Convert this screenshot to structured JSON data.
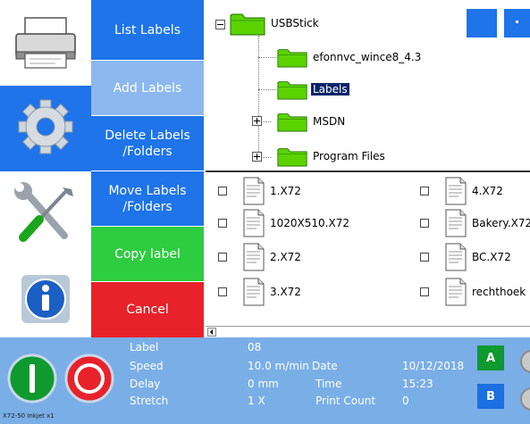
{
  "rail": {
    "items": [
      {
        "name": "printer"
      },
      {
        "name": "settings"
      },
      {
        "name": "tools"
      },
      {
        "name": "info"
      }
    ]
  },
  "menu": {
    "list_labels": "List Labels",
    "add_labels": "Add Labels",
    "delete_labels": "Delete Labels\n/Folders",
    "move_labels": "Move Labels\n/Folders",
    "copy_label": "Copy label",
    "cancel": "Cancel"
  },
  "tree": {
    "root": "USBStick",
    "children": [
      "efonnvc_wince8_4.3",
      "Labels",
      "MSDN",
      "Program Files"
    ]
  },
  "files": {
    "left": [
      "1.X72",
      "1020X510.X72",
      "2.X72",
      "3.X72"
    ],
    "right": [
      "4.X72",
      "Bakery.X72",
      "BC.X72",
      "rechthoek"
    ]
  },
  "status": {
    "label_key": "Label",
    "label_value": "08",
    "speed_key": "Speed",
    "speed_value": "10.0 m/min",
    "delay_key": "Delay",
    "delay_value": "0 mm",
    "stretch_key": "Stretch",
    "stretch_value": "1 X",
    "date_key": "Date",
    "date_value": "10/12/2018",
    "time_key": "Time",
    "time_value": "15:23",
    "count_key": "Print Count",
    "count_value": "0",
    "button_a": "A",
    "button_b": "B",
    "device": "X72-50 Inkjet x1"
  },
  "colors": {
    "menu_blue": "#1e74e8",
    "menu_light_blue": "#8cb8ef",
    "menu_green": "#2ecc40",
    "menu_red": "#e8222a",
    "status_bar": "#7aaee6",
    "folder_green": "#5bd300",
    "button_green": "#0e9a2e",
    "button_blue": "#1b6fe0"
  }
}
